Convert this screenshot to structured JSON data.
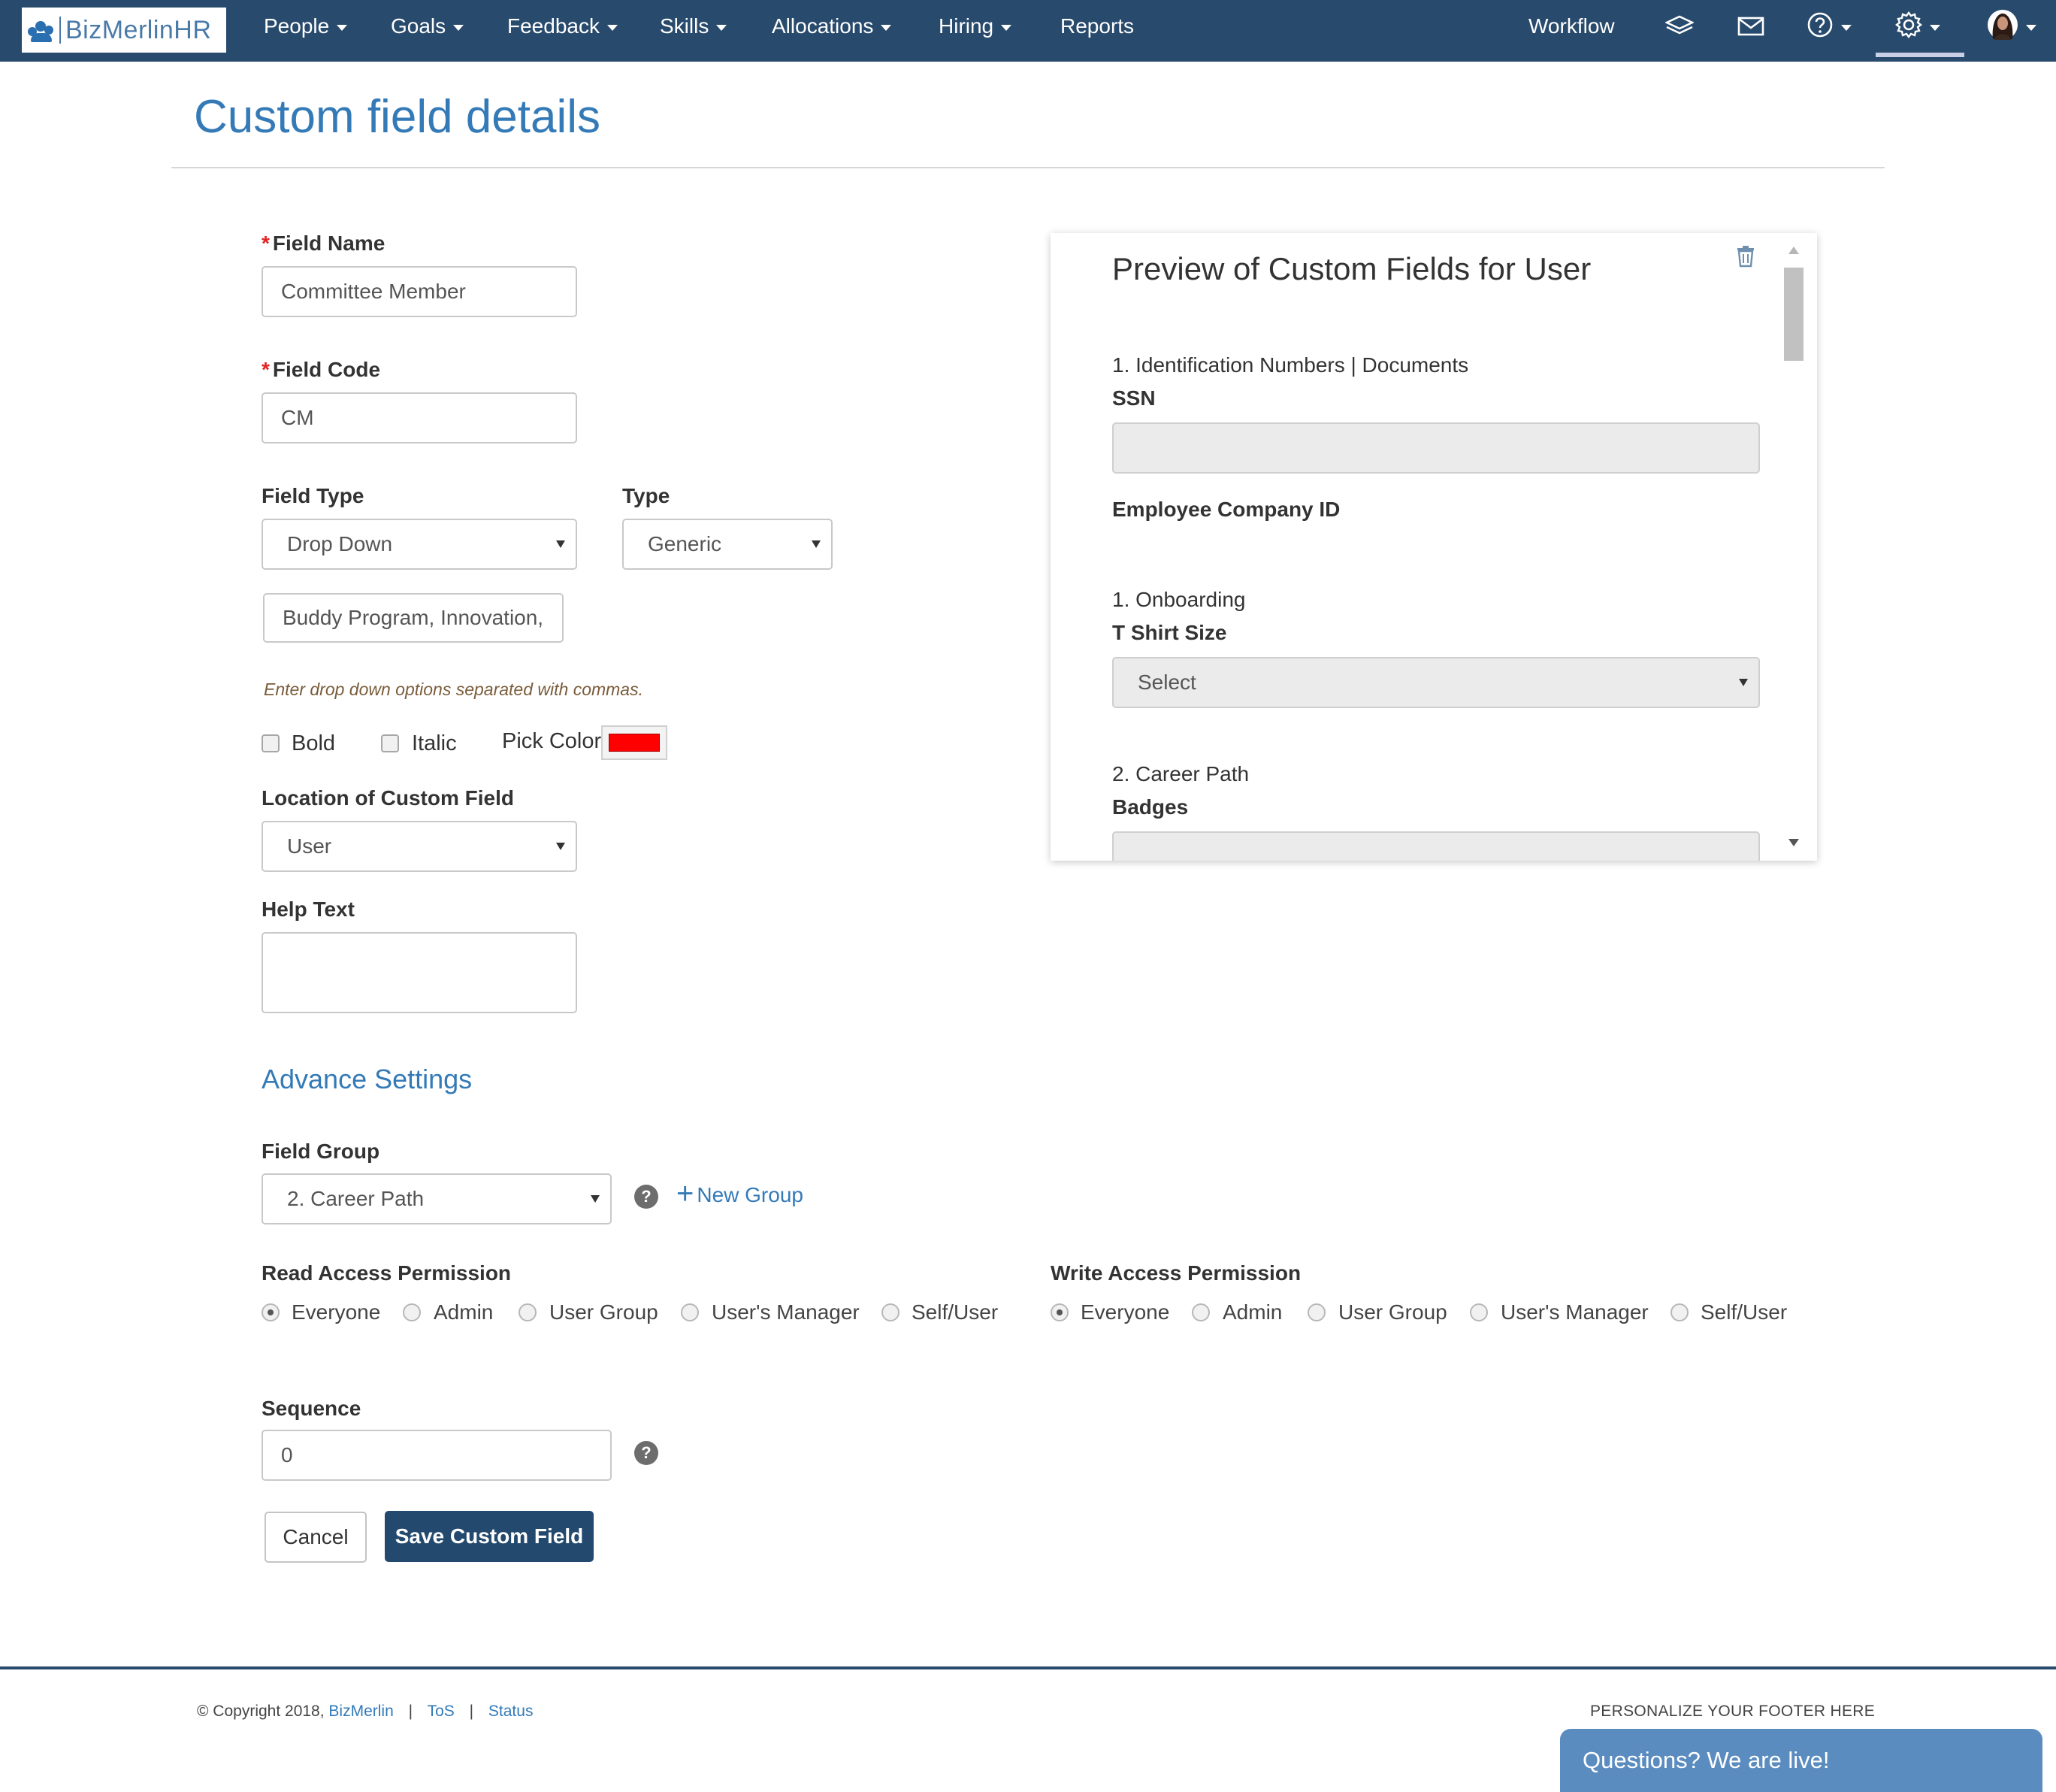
{
  "brand": {
    "name": "BizMerlinHR"
  },
  "nav": {
    "menu": [
      {
        "label": "People",
        "has_caret": true
      },
      {
        "label": "Goals",
        "has_caret": true
      },
      {
        "label": "Feedback",
        "has_caret": true
      },
      {
        "label": "Skills",
        "has_caret": true
      },
      {
        "label": "Allocations",
        "has_caret": true
      },
      {
        "label": "Hiring",
        "has_caret": true
      },
      {
        "label": "Reports",
        "has_caret": false
      }
    ],
    "workflow": "Workflow",
    "icons": [
      "layers-icon",
      "mail-icon",
      "help-icon",
      "settings-icon",
      "user-avatar"
    ]
  },
  "page": {
    "title": "Custom field details"
  },
  "form": {
    "field_name": {
      "label": "Field Name",
      "value": "Committee Member"
    },
    "field_code": {
      "label": "Field Code",
      "value": "CM"
    },
    "field_type": {
      "label": "Field Type",
      "value": "Drop Down"
    },
    "type": {
      "label": "Type",
      "value": "Generic"
    },
    "options": {
      "value": "Buddy Program, Innovation, ",
      "hint": "Enter drop down options separated with commas."
    },
    "bold": {
      "label": "Bold",
      "checked": false
    },
    "italic": {
      "label": "Italic",
      "checked": false
    },
    "pick_color": {
      "label": "Pick Color",
      "value": "#ff0000"
    },
    "location": {
      "label": "Location of Custom Field",
      "value": "User"
    },
    "help_text": {
      "label": "Help Text",
      "value": ""
    },
    "advance_settings": "Advance Settings",
    "field_group": {
      "label": "Field Group",
      "value": "2. Career Path",
      "new_group": "New Group"
    },
    "read_access": {
      "label": "Read Access Permission",
      "options": [
        "Everyone",
        "Admin",
        "User Group",
        "User's Manager",
        "Self/User"
      ],
      "selected": "Everyone"
    },
    "write_access": {
      "label": "Write Access Permission",
      "options": [
        "Everyone",
        "Admin",
        "User Group",
        "User's Manager",
        "Self/User"
      ],
      "selected": "Everyone"
    },
    "sequence": {
      "label": "Sequence",
      "value": "0"
    },
    "cancel": "Cancel",
    "save": "Save Custom Field"
  },
  "preview": {
    "title": "Preview of Custom Fields for User",
    "group1": "1. Identification Numbers | Documents",
    "ssn_label": "SSN",
    "ssn_value": "",
    "company_id_label": "Employee Company ID",
    "group2": "1. Onboarding",
    "tshirt_label": "T Shirt Size",
    "tshirt_value": "Select",
    "group3": "2. Career Path",
    "badges_label": "Badges"
  },
  "footer": {
    "copyright": "© Copyright 2018,",
    "company": "BizMerlin",
    "tos": "ToS",
    "status": "Status",
    "right_text": "PERSONALIZE YOUR FOOTER HERE",
    "chat": "Questions? We are live!"
  },
  "colors": {
    "nav_bg": "#284a6c",
    "accent": "#337ab7",
    "save_button": "#234a6e",
    "chat_widget": "#5b8cc0"
  }
}
